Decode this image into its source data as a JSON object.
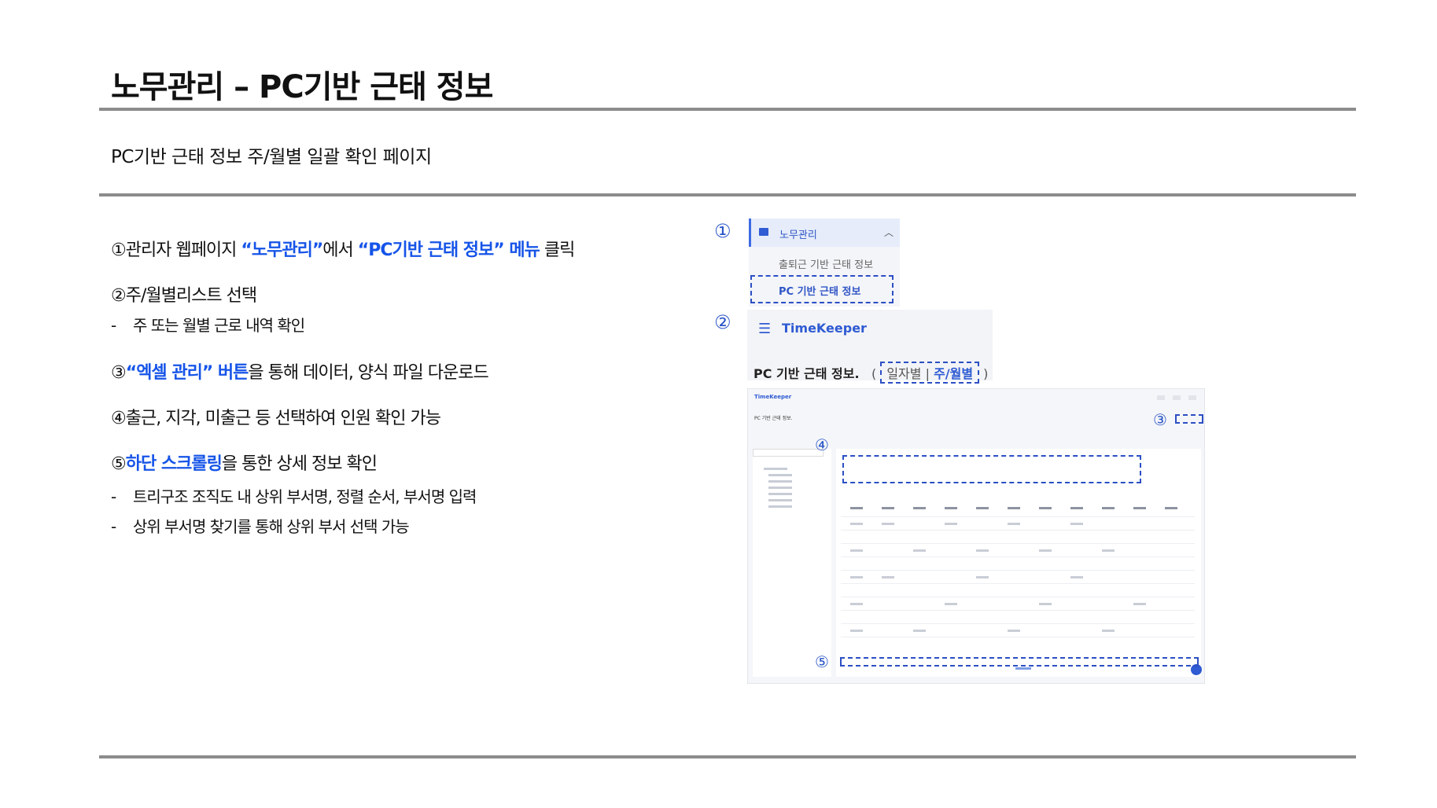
{
  "header": {
    "title": "노무관리 – PC기반 근태 정보",
    "subtitle": "PC기반 근태 정보 주/월별 일괄 확인 페이지"
  },
  "steps": [
    {
      "num": "①",
      "pre": "관리자 웹페이지 ",
      "hl1": "“노무관리”",
      "mid": "에서 ",
      "hl2": "“PC기반 근태 정보” 메뉴",
      "post": " 클릭"
    },
    {
      "num": "②",
      "text": "주/월별리스트 선택"
    },
    {
      "sub": "주 또는 월별 근로 내역 확인"
    },
    {
      "num": "③",
      "hl1": "“엑셀 관리” 버튼",
      "post": "을 통해 데이터, 양식 파일 다운로드"
    },
    {
      "num": "④",
      "text": "출근, 지각, 미출근 등 선택하여 인원 확인 가능"
    },
    {
      "num": "⑤",
      "hl1": "하단 스크롤링",
      "post": "을 통한 상세 정보 확인"
    },
    {
      "sub": "트리구조 조직도 내 상위 부서명, 정렬 순서, 부서명 입력"
    },
    {
      "sub": "상위 부서명 찾기를 통해 상위 부서 선택 가능"
    }
  ],
  "callouts": [
    "①",
    "②",
    "③",
    "④",
    "⑤"
  ],
  "menu_panel": {
    "section_label": "노무관리",
    "item_1": "출퇴근 기반 근태 정보",
    "item_2": "PC 기반 근태 정보"
  },
  "app_bar": {
    "brand": "TimeKeeper",
    "page_title": "PC 기반 근태 정보.",
    "tab_daily": "일자별",
    "tab_weekly": "주/월별"
  },
  "colors": {
    "accent": "#1654e8",
    "callout": "#2c4fc4",
    "rule": "#8c8c8c"
  }
}
